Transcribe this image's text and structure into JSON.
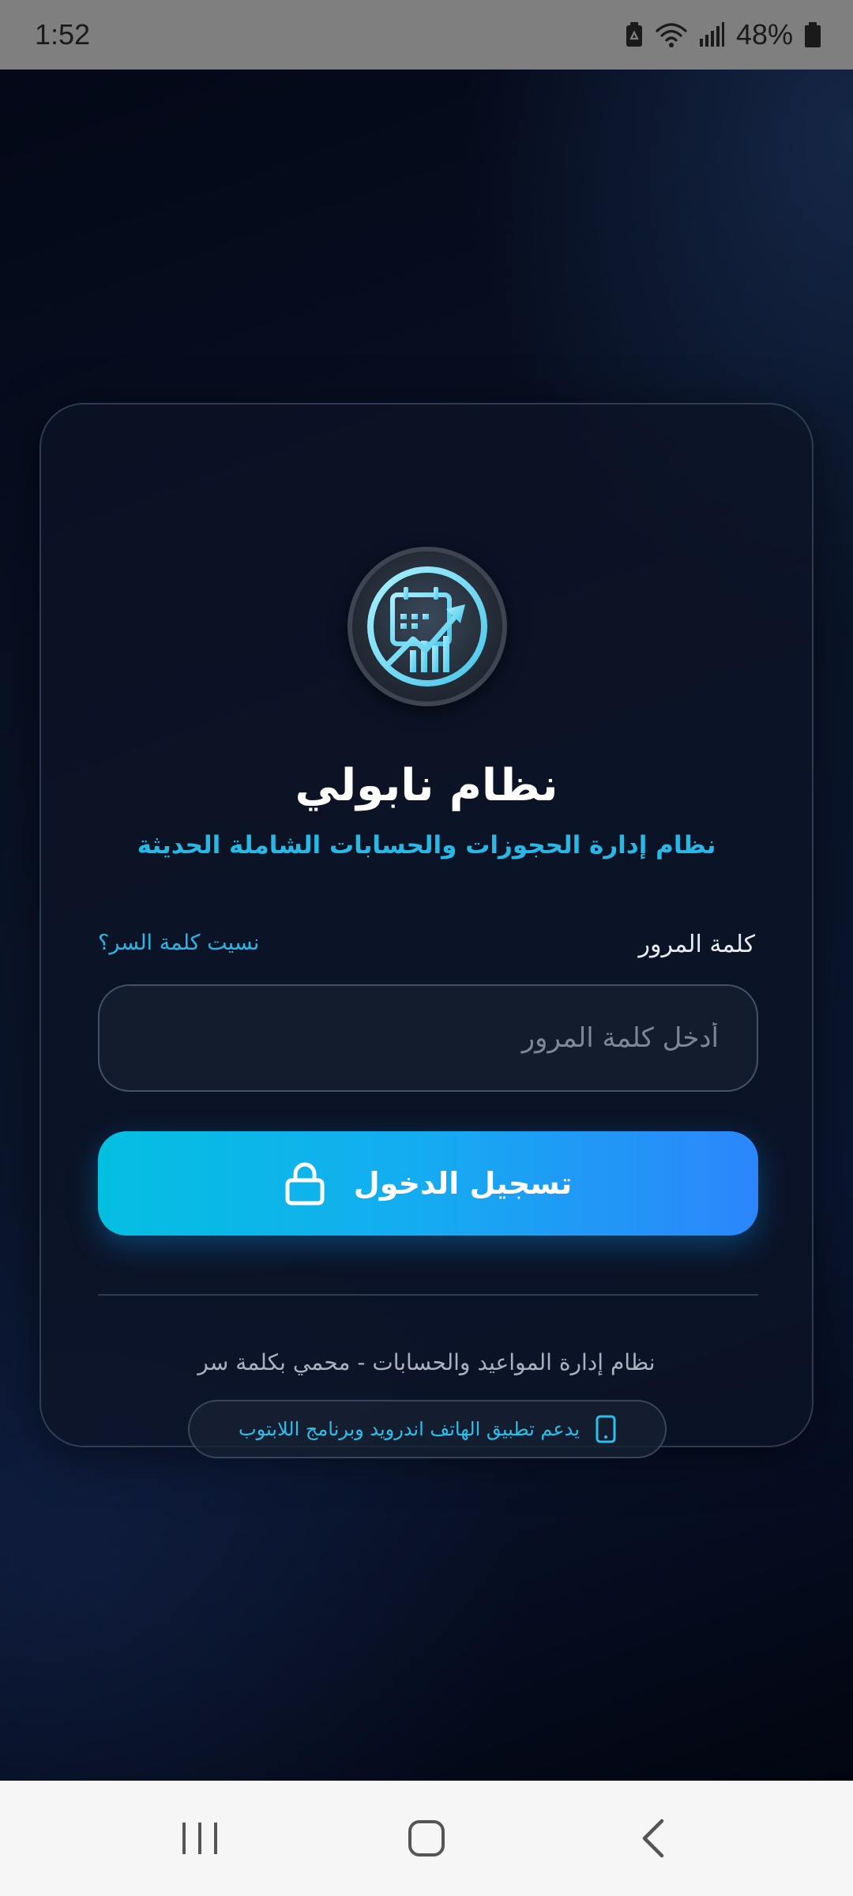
{
  "status_bar": {
    "time": "1:52",
    "battery": "48%",
    "icons": [
      "battery-saver-icon",
      "wifi-icon",
      "signal-icon",
      "battery-icon"
    ]
  },
  "app": {
    "title": "نظام نابولي",
    "subtitle": "نظام إدارة الحجوزات والحسابات الشاملة الحديثة",
    "logo_icon": "calendar-growth-chart-icon"
  },
  "form": {
    "password_label": "كلمة المرور",
    "forgot_password": "نسيت كلمة السر؟",
    "password_placeholder": "أدخل كلمة المرور",
    "password_value": "",
    "login_button": "تسجيل الدخول",
    "login_icon": "lock-icon"
  },
  "footer": {
    "description": "نظام إدارة المواعيد والحسابات - محمي بكلمة سر",
    "support_text": "يدعم تطبيق الهاتف اندرويد وبرنامج اللابتوب",
    "support_icon": "phone-icon"
  },
  "nav_bar": {
    "buttons": [
      "recents-icon",
      "home-icon",
      "back-icon"
    ]
  },
  "colors": {
    "accent": "#28b8e6",
    "button_start": "#04bfe0",
    "button_end": "#2c86fb",
    "background": "#050a18"
  }
}
